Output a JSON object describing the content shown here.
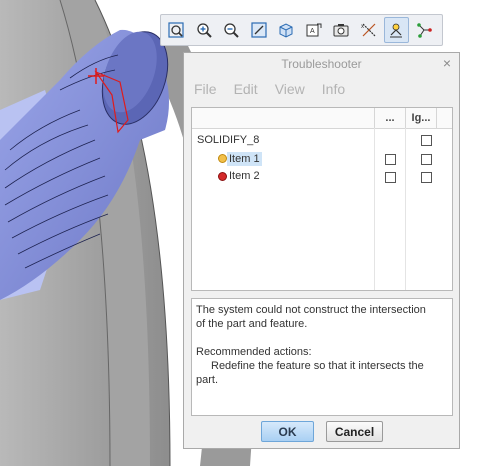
{
  "toolbar": {
    "buttons": [
      {
        "icon": "zoom-window-icon"
      },
      {
        "icon": "zoom-in-icon"
      },
      {
        "icon": "zoom-out-icon"
      },
      {
        "icon": "refit-icon"
      },
      {
        "icon": "view-orientation-icon"
      },
      {
        "icon": "annotation-display-icon"
      },
      {
        "icon": "camera-icon"
      },
      {
        "icon": "datum-axes-icon"
      },
      {
        "icon": "spin-center-icon",
        "active": true
      },
      {
        "icon": "datum-points-icon"
      }
    ]
  },
  "dialog": {
    "title": "Troubleshooter",
    "close_glyph": "×",
    "menu": [
      "File",
      "Edit",
      "View",
      "Info"
    ],
    "columns": [
      "...",
      "Ig..."
    ],
    "tree": {
      "root": "SOLIDIFY_8",
      "items": [
        {
          "label": "Item 1",
          "status_color": "#e0a020",
          "selected": true
        },
        {
          "label": "Item 2",
          "status_color": "#cc2020",
          "selected": false
        }
      ]
    },
    "message": {
      "line1": "The system could not construct the intersection",
      "line2": "of the part and feature.",
      "heading": "Recommended actions:",
      "action1": "Redefine the feature so that it intersects the",
      "action2": "part."
    },
    "ok_label": "OK",
    "cancel_label": "Cancel"
  }
}
